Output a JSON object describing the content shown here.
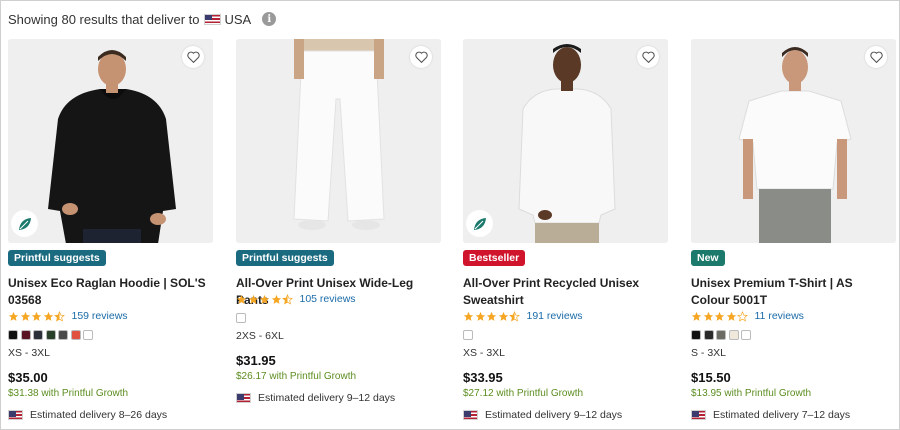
{
  "results": {
    "prefix": "Showing 80 results that deliver to",
    "country": "USA"
  },
  "colors": {
    "price_growth": "#5c8d1f",
    "review_link": "#1b6ba8",
    "badge_teal": "#1a6a80",
    "badge_red": "#d0142c",
    "badge_green": "#1c7a6c",
    "star": "#f5a623"
  },
  "products": [
    {
      "badge": "Printful suggests",
      "title": "Unisex Eco Raglan Hoodie | SOL'S 03568",
      "rating": 4.5,
      "reviews": "159 reviews",
      "swatches": [
        "#111111",
        "#5a1422",
        "#2b2f3a",
        "#28402a",
        "#4a4a4a",
        "#e0523f",
        "#ffffff"
      ],
      "sizes": "XS - 3XL",
      "price": "$35.00",
      "growth": "$31.38 with Printful Growth",
      "delivery": "Estimated delivery 8–26 days",
      "eco": true
    },
    {
      "badge": "Printful suggests",
      "title": "All-Over Print Unisex Wide-Leg Pants",
      "rating": 4.5,
      "reviews": "105 reviews",
      "swatches": [
        "#ffffff"
      ],
      "sizes": "2XS - 6XL",
      "price": "$31.95",
      "growth": "$26.17 with Printful Growth",
      "delivery": "Estimated delivery 9–12 days",
      "eco": false
    },
    {
      "badge": "Bestseller",
      "title": "All-Over Print Recycled Unisex Sweatshirt",
      "rating": 4.5,
      "reviews": "191 reviews",
      "swatches": [
        "#ffffff"
      ],
      "sizes": "XS - 3XL",
      "price": "$33.95",
      "growth": "$27.12 with Printful Growth",
      "delivery": "Estimated delivery 9–12 days",
      "eco": true
    },
    {
      "badge": "New",
      "title": "Unisex Premium T-Shirt | AS Colour 5001T",
      "rating": 4,
      "reviews": "11 reviews",
      "swatches": [
        "#111111",
        "#2a2a2a",
        "#6b6b64",
        "#efe9dc",
        "#ffffff"
      ],
      "sizes": "S - 3XL",
      "price": "$15.50",
      "growth": "$13.95 with Printful Growth",
      "delivery": "Estimated delivery 7–12 days",
      "eco": false
    }
  ]
}
